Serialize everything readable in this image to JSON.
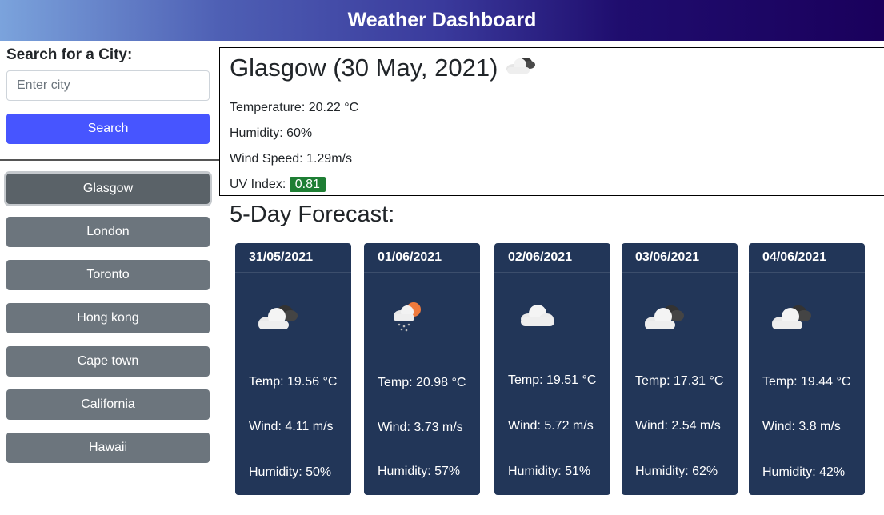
{
  "header": {
    "title": "Weather Dashboard"
  },
  "search": {
    "label": "Search for a City:",
    "placeholder": "Enter city",
    "button_label": "Search"
  },
  "history": {
    "active": "Glasgow",
    "cities": [
      "Glasgow",
      "London",
      "Toronto",
      "Hong kong",
      "Cape town",
      "California",
      "Hawaii"
    ]
  },
  "current": {
    "title": "Glasgow (30 May, 2021)",
    "icon": "cloudy-icon",
    "temperature": "Temperature: 20.22 °C",
    "humidity": "Humidity: 60%",
    "wind": "Wind Speed: 1.29m/s",
    "uv_label": "UV Index:",
    "uv_value": "0.81",
    "uv_color": "#1e7e34"
  },
  "forecast": {
    "title": "5-Day Forecast:",
    "card_color": "#223658",
    "days": [
      {
        "date": "31/05/2021",
        "icon": "cloudy-icon",
        "temp": "Temp: 19.56 °C",
        "wind": "Wind: 4.11 m/s",
        "humidity": "Humidity: 50%"
      },
      {
        "date": "01/06/2021",
        "icon": "rain-sun-icon",
        "temp": "Temp: 20.98 °C",
        "wind": "Wind: 3.73 m/s",
        "humidity": "Humidity: 57%"
      },
      {
        "date": "02/06/2021",
        "icon": "cloud-icon",
        "temp": "Temp: 19.51 °C",
        "wind": "Wind: 5.72 m/s",
        "humidity": "Humidity: 51%"
      },
      {
        "date": "03/06/2021",
        "icon": "cloudy-icon",
        "temp": "Temp: 17.31 °C",
        "wind": "Wind: 2.54 m/s",
        "humidity": "Humidity: 62%"
      },
      {
        "date": "04/06/2021",
        "icon": "cloudy-icon",
        "temp": "Temp: 19.44 °C",
        "wind": "Wind: 3.8 m/s",
        "humidity": "Humidity: 42%"
      }
    ]
  }
}
